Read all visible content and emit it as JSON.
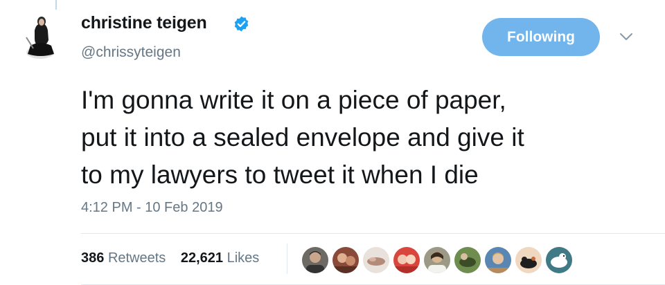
{
  "user": {
    "display_name": "christine teigen",
    "handle": "@chrissyteigen",
    "verified_icon": "verified-badge-icon",
    "verified_color": "#1da1f2"
  },
  "actions": {
    "follow_label": "Following",
    "follow_color": "#71b5ec",
    "menu_icon": "chevron-down-icon"
  },
  "tweet": {
    "lines": [
      "I'm gonna write it on a piece of paper,",
      "put it into a sealed envelope and give it",
      "to my lawyers to tweet it when I die"
    ],
    "timestamp": "4:12 PM - 10 Feb 2019"
  },
  "stats": {
    "retweets_count": "386",
    "retweets_label": "Retweets",
    "likes_count": "22,621",
    "likes_label": "Likes"
  },
  "liker_avatars": [
    {
      "name": "liker-1"
    },
    {
      "name": "liker-2"
    },
    {
      "name": "liker-3"
    },
    {
      "name": "liker-4"
    },
    {
      "name": "liker-5"
    },
    {
      "name": "liker-6"
    },
    {
      "name": "liker-7"
    },
    {
      "name": "liker-8"
    },
    {
      "name": "liker-9"
    }
  ]
}
